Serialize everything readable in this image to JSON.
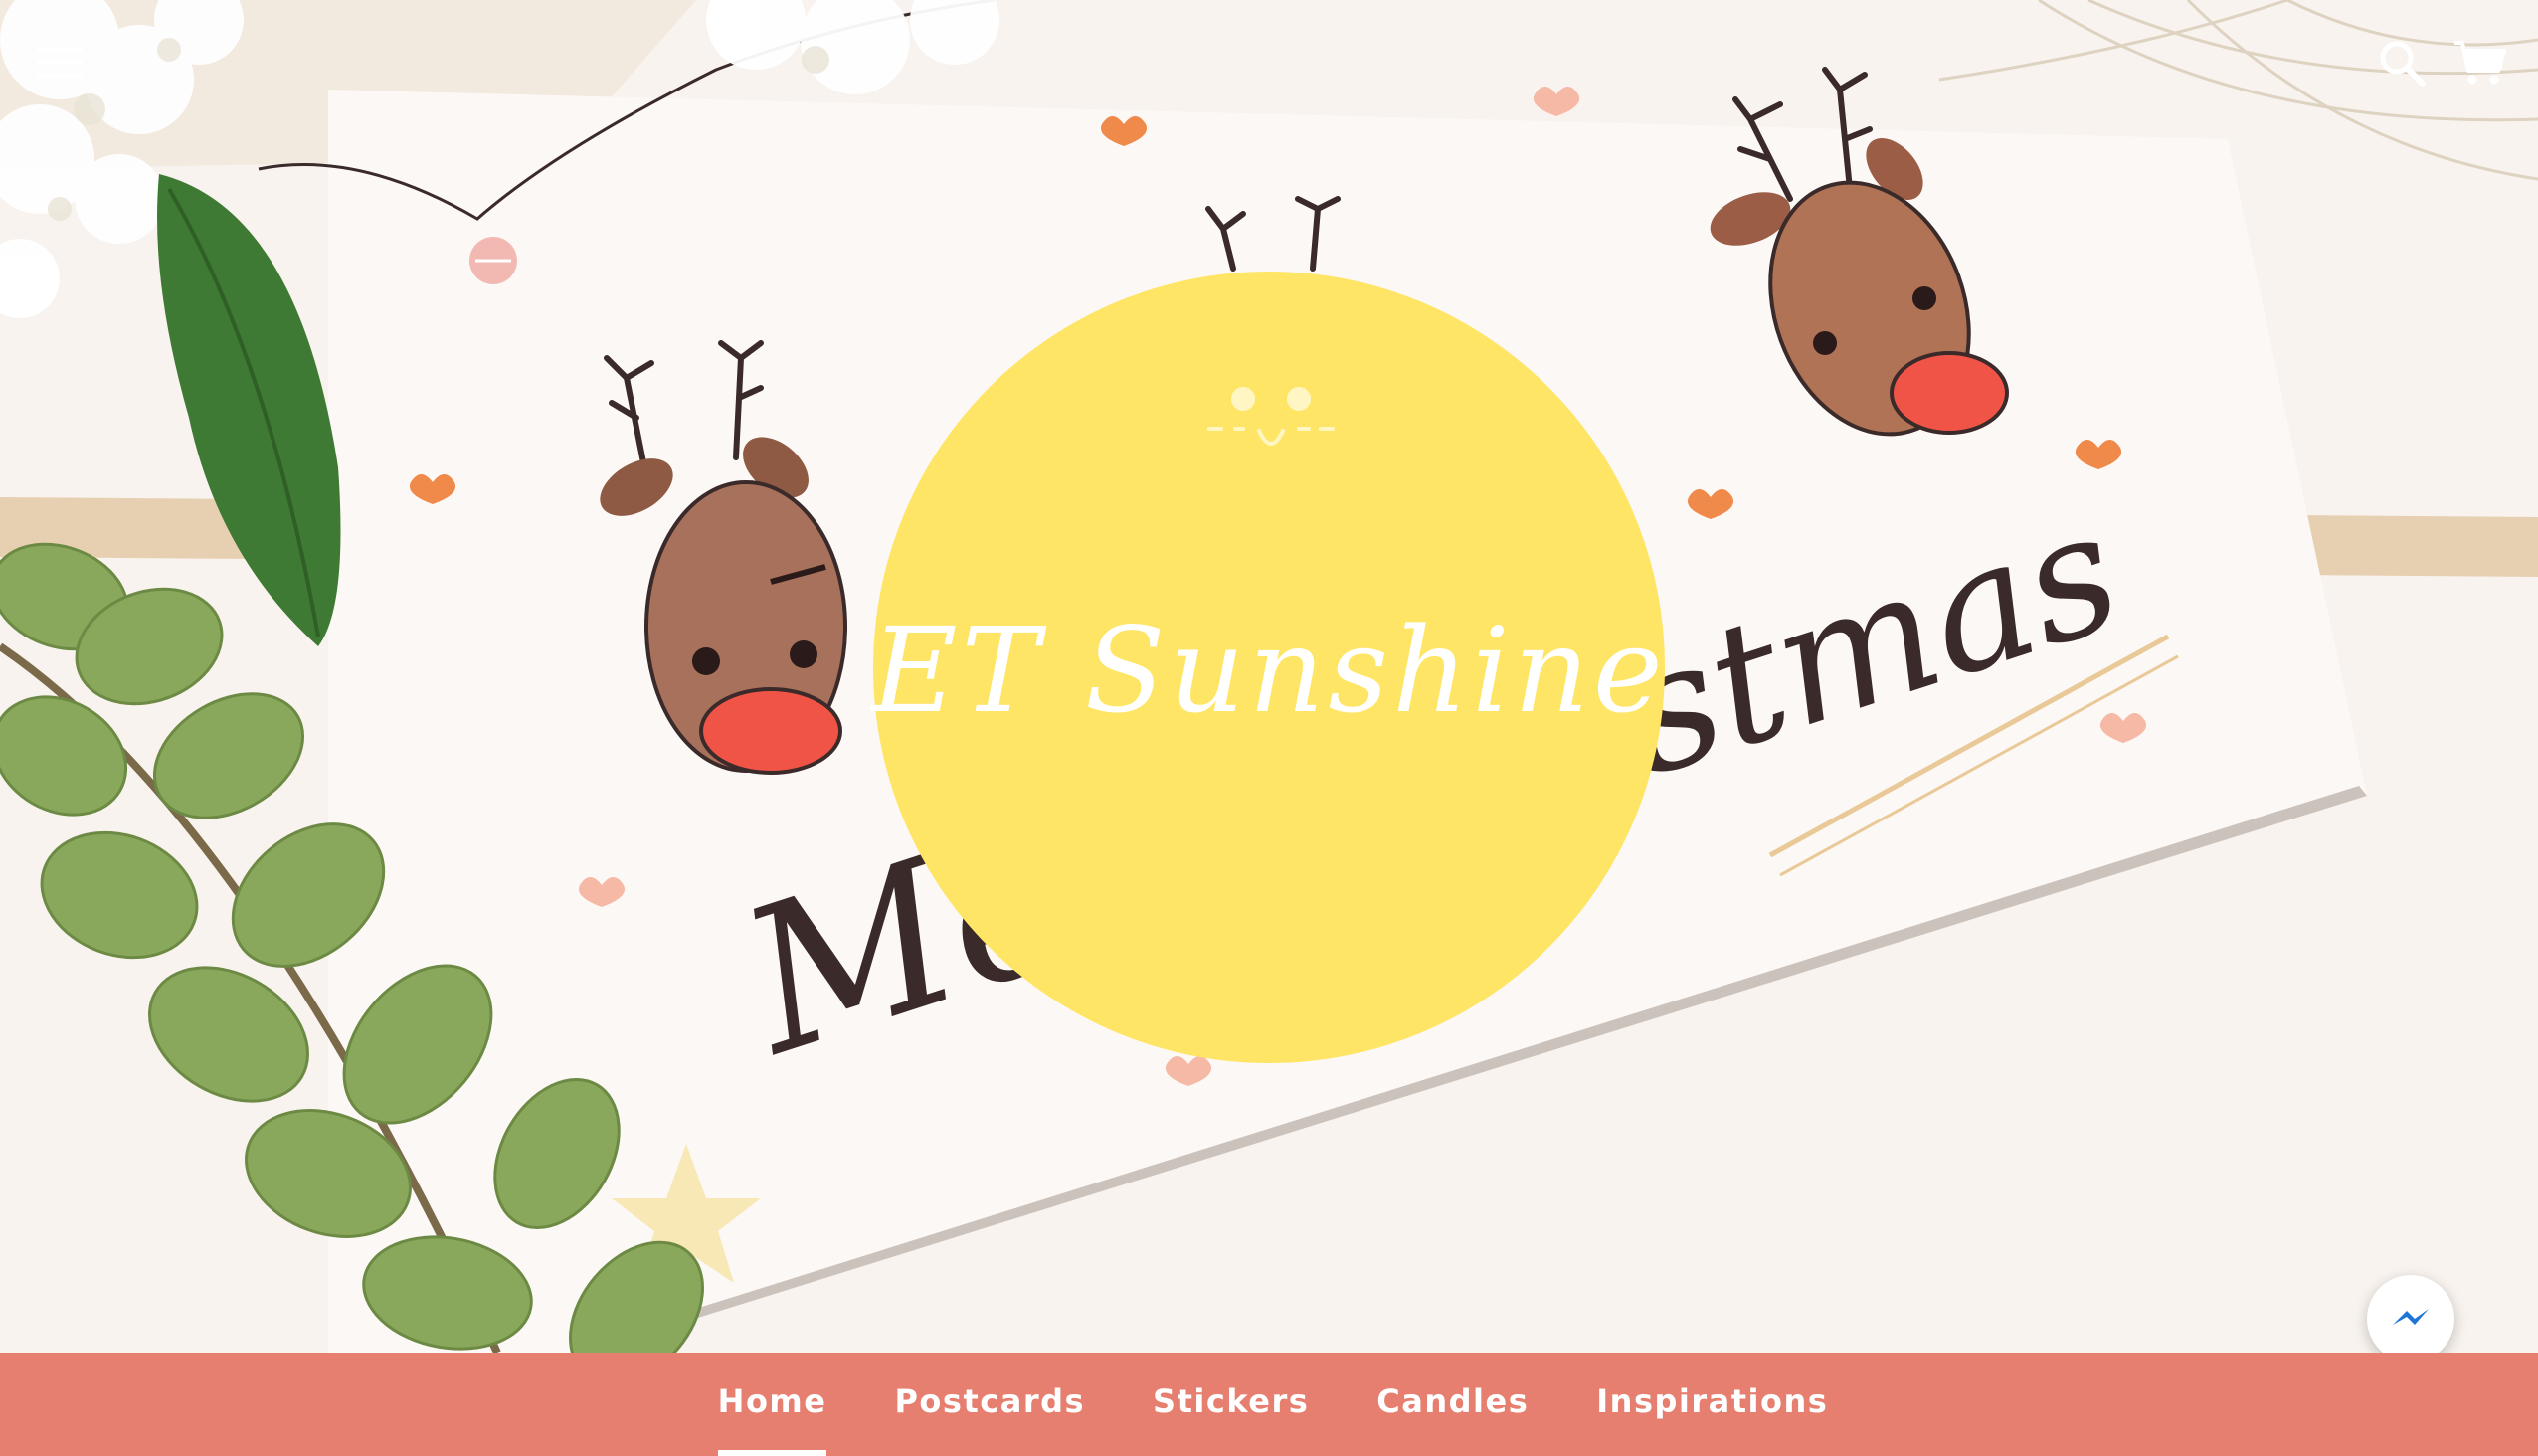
{
  "header": {
    "menu_icon": "hamburger-menu-icon",
    "search_icon": "search-icon",
    "cart_icon": "cart-icon"
  },
  "logo": {
    "text": "ET Sunshine",
    "background_color": "#ffe566",
    "text_color": "#ffffff"
  },
  "nav": {
    "background_color": "#e67f6f",
    "items": [
      {
        "label": "Home",
        "active": true
      },
      {
        "label": "Postcards",
        "active": false
      },
      {
        "label": "Stickers",
        "active": false
      },
      {
        "label": "Candles",
        "active": false
      },
      {
        "label": "Inspirations",
        "active": false
      }
    ]
  },
  "messenger": {
    "icon": "messenger-icon"
  }
}
